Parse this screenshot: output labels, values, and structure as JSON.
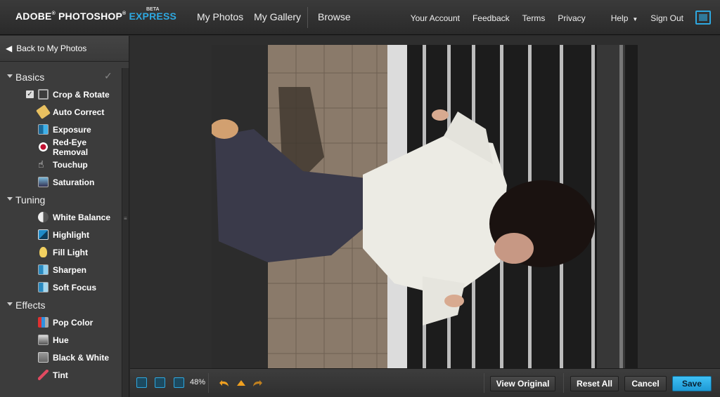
{
  "header": {
    "logo_main": "ADOBE",
    "logo_product": "PHOTOSHOP",
    "logo_express": "EXPRESS",
    "logo_beta": "BETA",
    "nav": [
      "My Photos",
      "My Gallery"
    ],
    "browse": "Browse",
    "account_links": [
      "Your Account",
      "Feedback",
      "Terms",
      "Privacy"
    ],
    "help": "Help",
    "sign_out": "Sign Out"
  },
  "sidebar": {
    "back_label": "Back to My Photos",
    "sections": [
      {
        "title": "Basics",
        "tools": [
          "Crop & Rotate",
          "Auto Correct",
          "Exposure",
          "Red-Eye Removal",
          "Touchup",
          "Saturation"
        ]
      },
      {
        "title": "Tuning",
        "tools": [
          "White Balance",
          "Highlight",
          "Fill Light",
          "Sharpen",
          "Soft Focus"
        ]
      },
      {
        "title": "Effects",
        "tools": [
          "Pop Color",
          "Hue",
          "Black & White",
          "Tint"
        ]
      }
    ]
  },
  "toolbar": {
    "zoom": "48%",
    "view_original": "View Original",
    "reset_all": "Reset All",
    "cancel": "Cancel",
    "save": "Save"
  },
  "colors": {
    "accent": "#2ea8e0",
    "save_button": "#2ea8e0"
  }
}
